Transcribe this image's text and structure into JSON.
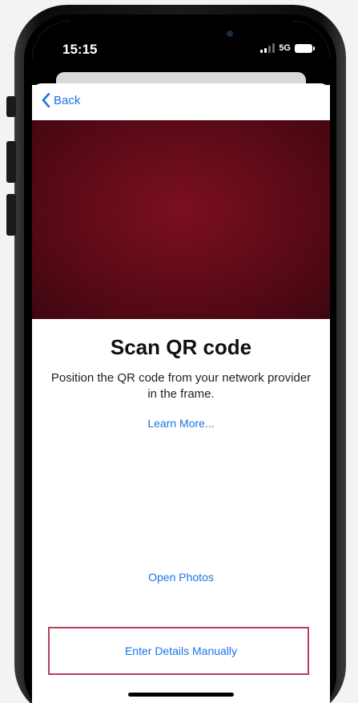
{
  "status_bar": {
    "time": "15:15",
    "network": "5G",
    "signal_icon": "signal-bars-icon",
    "battery_icon": "battery-icon"
  },
  "nav": {
    "back_label": "Back",
    "back_icon": "chevron-left-icon"
  },
  "scanner": {
    "title": "Scan QR code",
    "subtitle": "Position the QR code from your network provider in the frame.",
    "learn_more": "Learn More..."
  },
  "actions": {
    "open_photos": "Open Photos",
    "enter_manually": "Enter Details Manually"
  },
  "colors": {
    "accent": "#1a73e8",
    "camera_tint": "#6b0d1c",
    "highlight_border": "#b63f57"
  }
}
